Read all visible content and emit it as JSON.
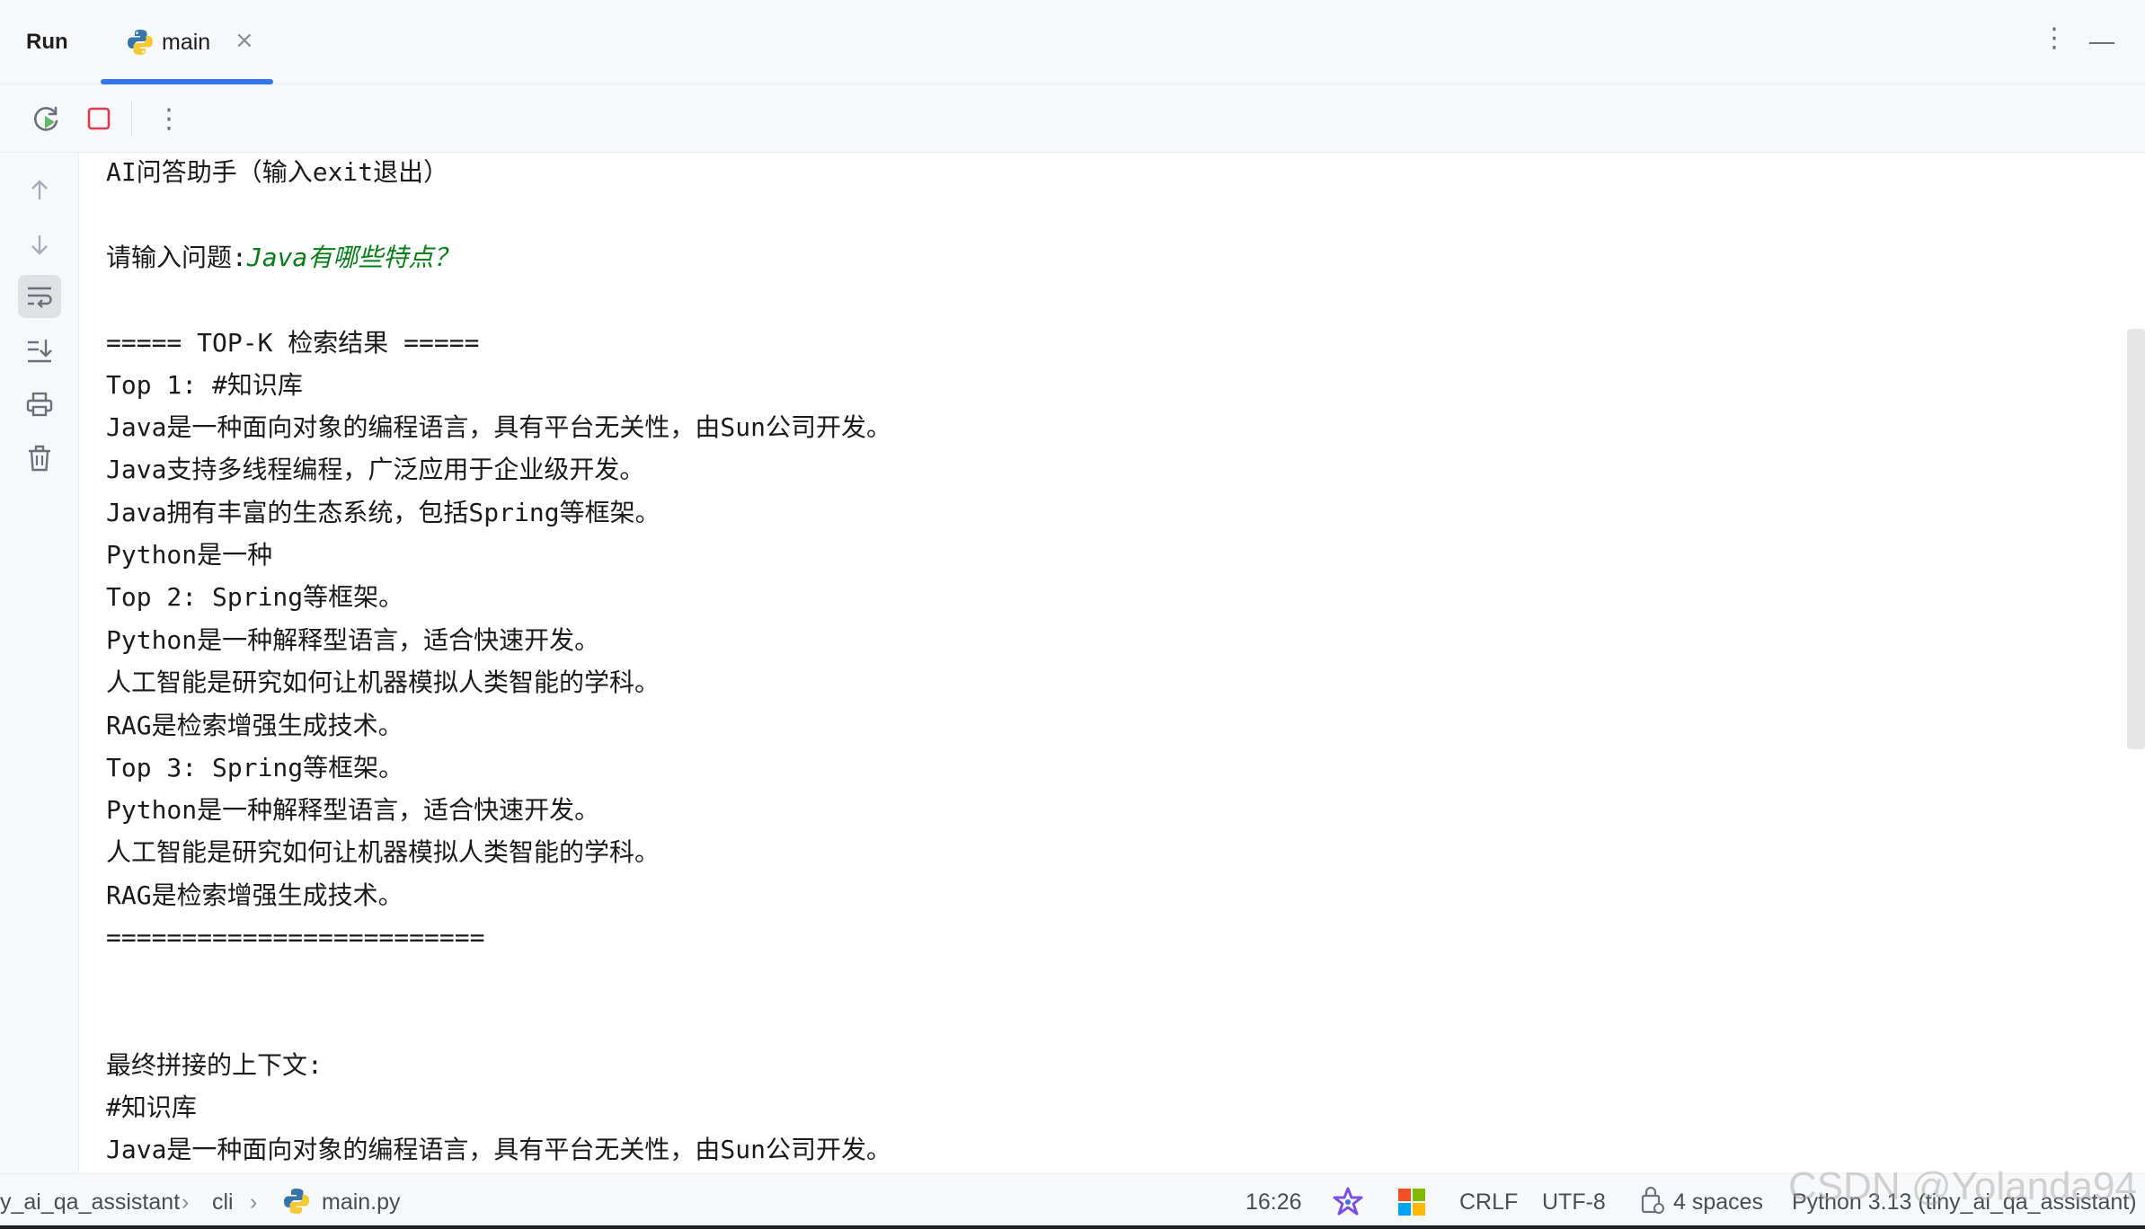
{
  "header": {
    "panel_title": "Run",
    "tab_label": "main",
    "tab_close": "×",
    "more_icon": "⋮"
  },
  "toolbar": {
    "rerun_icon": "rerun-icon",
    "stop_icon": "stop-icon",
    "more_icon": "⋮"
  },
  "gutter": {
    "icons": [
      "arrow-up-icon",
      "arrow-down-icon",
      "soft-wrap-icon",
      "scroll-to-end-icon",
      "print-icon",
      "trash-icon"
    ]
  },
  "console": {
    "line1": "AI问答助手（输入exit退出）",
    "prompt": "请输入问题:",
    "user_input": "Java有哪些特点？",
    "line3": "===== TOP-K 检索结果 =====",
    "line4": "Top 1: #知识库",
    "line5": "Java是一种面向对象的编程语言，具有平台无关性，由Sun公司开发。",
    "line6": "Java支持多线程编程，广泛应用于企业级开发。",
    "line7": "Java拥有丰富的生态系统，包括Spring等框架。",
    "line8": "Python是一种",
    "line9": "Top 2: Spring等框架。",
    "line10": "Python是一种解释型语言，适合快速开发。",
    "line11": "人工智能是研究如何让机器模拟人类智能的学科。",
    "line12": "RAG是检索增强生成技术。",
    "line13": "Top 3: Spring等框架。",
    "line14": "Python是一种解释型语言，适合快速开发。",
    "line15": "人工智能是研究如何让机器模拟人类智能的学科。",
    "line16": "RAG是检索增强生成技术。",
    "line17": "=========================",
    "line18": "最终拼接的上下文:",
    "line19": "#知识库",
    "line20": "Java是一种面向对象的编程语言，具有平台无关性，由Sun公司开发。"
  },
  "statusbar": {
    "crumb_project": "y_ai_qa_assistant",
    "crumb_sep": "›",
    "crumb_folder": "cli",
    "crumb_file": "main.py",
    "position": "16:26",
    "line_ending": "CRLF",
    "encoding": "UTF-8",
    "indent": "4 spaces",
    "interpreter": "Python 3.13 (tiny_ai_qa_assistant)"
  },
  "watermark": "CSDN @Yolanda94",
  "colors": {
    "accent": "#3574f0",
    "stop_red": "#db3b4b",
    "rerun_green": "#5fb865",
    "user_input_green": "#067d17"
  }
}
